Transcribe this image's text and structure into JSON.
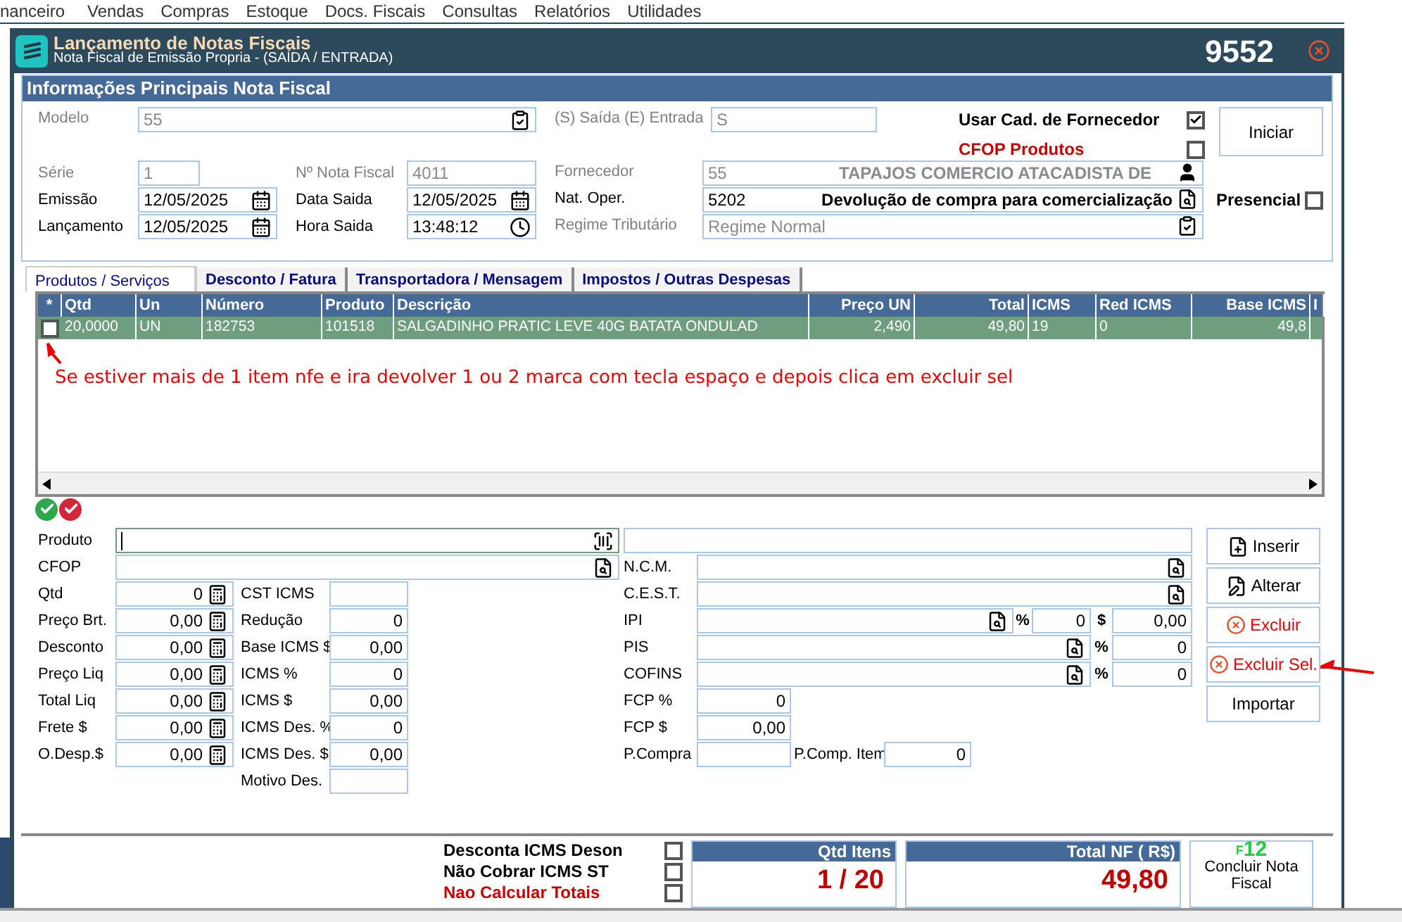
{
  "menu": [
    "nanceiro",
    "Vendas",
    "Compras",
    "Estoque",
    "Docs. Fiscais",
    "Consultas",
    "Relatórios",
    "Utilidades"
  ],
  "window": {
    "title": "Lançamento de Notas Fiscais",
    "subtitle": "Nota Fiscal de Emissão Propria - (SAÍDA / ENTRADA)",
    "number": "9552"
  },
  "main_info": {
    "title": "Informações Principais Nota Fiscal",
    "modelo": {
      "label": "Modelo",
      "value": "55",
      "disabled": true
    },
    "tipo": {
      "label": "(S) Saída (E) Entrada",
      "value": "S",
      "disabled": true
    },
    "options": [
      {
        "label": "Usar Cad. de Fornecedor",
        "checked": true,
        "kind": "normal"
      },
      {
        "label": "CFOP Produtos",
        "checked": false,
        "kind": "alert"
      }
    ],
    "start_button": "Iniciar",
    "serie": {
      "label": "Série",
      "value": "1",
      "disabled": true
    },
    "numero": {
      "label": "Nº Nota Fiscal",
      "value": "4011",
      "disabled": true
    },
    "emissao": {
      "label": "Emissão",
      "value": "12/05/2025",
      "disabled": false
    },
    "data_saida": {
      "label": "Data Saida",
      "value": "12/05/2025",
      "disabled": false
    },
    "lancamento": {
      "label": "Lançamento",
      "value": "12/05/2025",
      "disabled": false
    },
    "hora_saida": {
      "label": "Hora Saida",
      "value": "13:48:12",
      "disabled": false
    },
    "fornecedor": {
      "label": "Fornecedor",
      "code": "55",
      "name": "TAPAJOS COMERCIO ATACADISTA DE",
      "disabled": true
    },
    "nat_oper": {
      "label": "Nat. Oper.",
      "code": "5202",
      "name": "Devolução de compra para comercialização",
      "disabled": false
    },
    "regime": {
      "label": "Regime Tributário",
      "value": "Regime Normal",
      "disabled": true
    },
    "presencial": {
      "label": "Presencial",
      "checked": false
    }
  },
  "tabs": [
    {
      "label": "Produtos / Serviços",
      "selected": true
    },
    {
      "label": "Desconto / Fatura",
      "selected": false
    },
    {
      "label": "Transportadora / Mensagem",
      "selected": false
    },
    {
      "label": "Impostos / Outras Despesas",
      "selected": false
    }
  ],
  "grid": {
    "columns": [
      "*",
      "Qtd",
      "Un",
      "Número",
      "Produto",
      "Descrição",
      "Preço UN",
      "Total",
      "ICMS",
      "Red ICMS",
      "Base ICMS",
      "I"
    ],
    "rows": [
      {
        "selected": true,
        "checked": false,
        "cells": [
          "",
          "20,0000",
          "UN",
          "182753",
          "101518",
          "SALGADINHO PRATIC LEVE 40G BATATA ONDULAD",
          "2,490",
          "49,80",
          "19",
          "0",
          "49,8"
        ]
      }
    ],
    "annotation": "Se estiver mais de 1 item nfe e ira devolver 1 ou 2 marca com tecla espaço e depois clica em excluir sel"
  },
  "item_form": {
    "produto": {
      "label": "Produto"
    },
    "cfop": {
      "label": "CFOP"
    },
    "left_fields": [
      {
        "label": "Qtd",
        "value": "0"
      },
      {
        "label": "Preço Brt.",
        "value": "0,00"
      },
      {
        "label": "Desconto",
        "value": "0,00"
      },
      {
        "label": "Preço Liq",
        "value": "0,00"
      },
      {
        "label": "Total Liq",
        "value": "0,00"
      },
      {
        "label": "Frete $",
        "value": "0,00"
      },
      {
        "label": "O.Desp.$",
        "value": "0,00"
      }
    ],
    "mid_fields": [
      {
        "label": "CST ICMS"
      },
      {
        "label": "Redução",
        "value": "0"
      },
      {
        "label": "Base ICMS $",
        "value": "0,00"
      },
      {
        "label": "ICMS %",
        "value": "0"
      },
      {
        "label": "ICMS $",
        "value": "0,00"
      },
      {
        "label": "ICMS Des. %",
        "value": "0"
      },
      {
        "label": "ICMS Des. $",
        "value": "0,00"
      },
      {
        "label": "Motivo Des."
      }
    ],
    "right_fields": [
      {
        "kind": "lookup",
        "label": "N.C.M."
      },
      {
        "kind": "lookup",
        "label": "C.E.S.T."
      },
      {
        "kind": "rate_amount",
        "label": "IPI",
        "rate_sign": "%",
        "rate": "0",
        "amount_sign": "$",
        "amount": "0,00"
      },
      {
        "kind": "rate",
        "label": "PIS",
        "rate_sign": "%",
        "rate": "0"
      },
      {
        "kind": "rate",
        "label": "COFINS",
        "rate_sign": "%",
        "rate": "0"
      },
      {
        "kind": "number",
        "label": "FCP %",
        "value": "0"
      },
      {
        "kind": "number",
        "label": "FCP $",
        "value": "0,00"
      },
      {
        "kind": "double",
        "label": "P.Compra",
        "label2": "P.Comp. Item",
        "value2": "0"
      }
    ],
    "buttons": [
      {
        "label": "Inserir",
        "kind": "add"
      },
      {
        "label": "Alterar",
        "kind": "edit"
      },
      {
        "label": "Excluir",
        "kind": "delete"
      },
      {
        "label": "Excluir Sel.",
        "kind": "delete_selected"
      },
      {
        "label": "Importar",
        "kind": "plain"
      }
    ]
  },
  "footer": {
    "options": [
      {
        "label": "Desconta ICMS Deson",
        "checked": false,
        "kind": "normal"
      },
      {
        "label": "Não Cobrar ICMS ST",
        "checked": false,
        "kind": "normal"
      },
      {
        "label": "Nao Calcular Totais",
        "checked": false,
        "kind": "alert"
      }
    ],
    "qtd_itens": {
      "title": "Qtd Itens",
      "value": "1 / 20"
    },
    "total": {
      "title": "Total NF ( R$)",
      "value": "49,80"
    },
    "conclude": {
      "key_prefix": "F",
      "key": "12",
      "label": "Concluir Nota Fiscal"
    }
  }
}
